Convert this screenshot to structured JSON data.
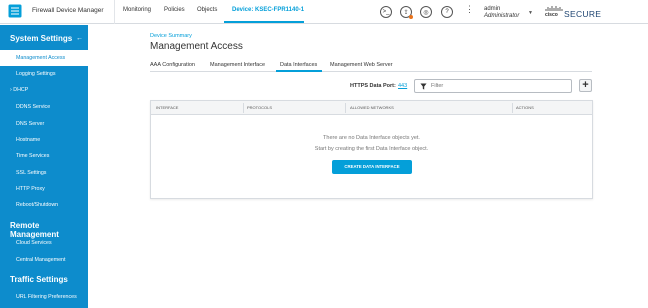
{
  "header": {
    "app_title": "Firewall Device Manager",
    "nav": [
      "Monitoring",
      "Policies",
      "Objects"
    ],
    "device_label": "Device: KSEC-FPR1140-1",
    "user_name": "admin",
    "user_role": "Administrator",
    "brand_cisco": "cisco",
    "brand_secure": "SECURE",
    "accent_color": "#049fd9"
  },
  "sidebar": {
    "color": "#0d8ccc",
    "sections": [
      {
        "title": "System Settings"
      },
      {
        "title": "Remote Management"
      },
      {
        "title": "Traffic Settings"
      }
    ],
    "items": [
      "Management Access",
      "Logging Settings",
      "DHCP",
      "DDNS Service",
      "DNS Server",
      "Hostname",
      "Time Services",
      "SSL Settings",
      "HTTP Proxy",
      "Reboot/Shutdown",
      "Cloud Services",
      "Central Management",
      "URL Filtering Preferences"
    ]
  },
  "main": {
    "breadcrumb": "Device Summary",
    "title": "Management Access",
    "tabs": [
      "AAA Configuration",
      "Management Interface",
      "Data Interfaces",
      "Management Web Server"
    ],
    "active_tab": "Data Interfaces",
    "https_label": "HTTPS Data Port:",
    "https_port": "443",
    "filter_placeholder": "Filter",
    "add_label": "+",
    "table": {
      "columns": [
        "Interface",
        "Protocols",
        "Allowed Networks",
        "Actions"
      ],
      "empty_line1": "There are no Data Interface objects yet.",
      "empty_line2": "Start by creating the first Data Interface object.",
      "create_button": "CREATE DATA INTERFACE"
    }
  }
}
